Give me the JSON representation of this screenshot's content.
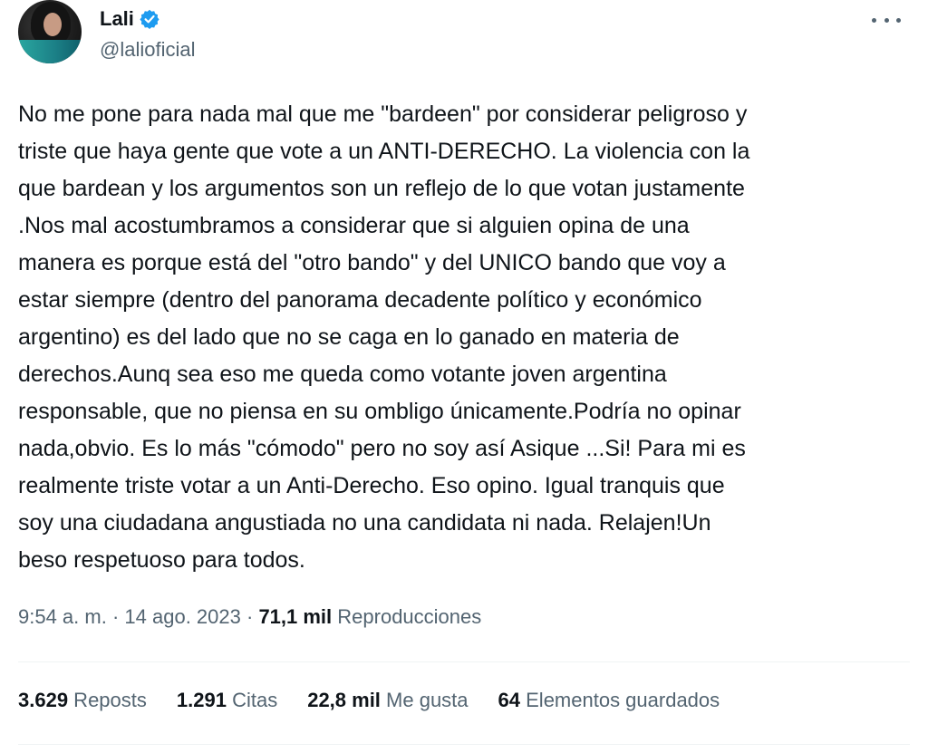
{
  "author": {
    "display_name": "Lali",
    "handle": "@lalioficial",
    "verified_icon": "verified-badge-icon",
    "avatar_icon": "profile-photo"
  },
  "tweet": {
    "lines": [
      "No me pone para nada mal que me \"bardeen\" por considerar peligroso y",
      "triste que haya gente que vote a un ANTI-DERECHO. La violencia con la",
      "que bardean y los argumentos son un reflejo de lo que votan justamente",
      ".Nos mal acostumbramos a considerar que si alguien opina de una",
      "manera es porque está del \"otro bando\" y del UNICO bando que voy a",
      "estar siempre (dentro del panorama decadente político y económico",
      "argentino) es del lado que no se caga en lo ganado en materia de",
      "derechos.Aunq sea eso me queda como votante joven argentina",
      "responsable, que no piensa en su ombligo únicamente.Podría no opinar",
      "nada,obvio. Es lo más \"cómodo\" pero no soy así Asique ...Si! Para mi es",
      "realmente triste votar a un Anti-Derecho. Eso opino. Igual tranquis que",
      "soy una ciudadana angustiada no una candidata ni nada. Relajen!Un",
      "beso respetuoso para todos."
    ]
  },
  "meta": {
    "time": "9:54 a. m.",
    "sep1": " · ",
    "date": "14 ago. 2023",
    "sep2": " · ",
    "views_count": "71,1 mil",
    "views_label": " Reproducciones"
  },
  "stats": {
    "reposts_count": "3.629",
    "reposts_label": " Reposts",
    "quotes_count": "1.291",
    "quotes_label": " Citas",
    "likes_count": "22,8 mil",
    "likes_label": " Me gusta",
    "bookmarks_count": "64",
    "bookmarks_label": " Elementos guardados"
  },
  "colors": {
    "text": "#0f1419",
    "secondary": "#536471",
    "verified": "#1d9bf0",
    "divider": "#eff3f4"
  },
  "icons": {
    "more": "more-options-icon"
  }
}
